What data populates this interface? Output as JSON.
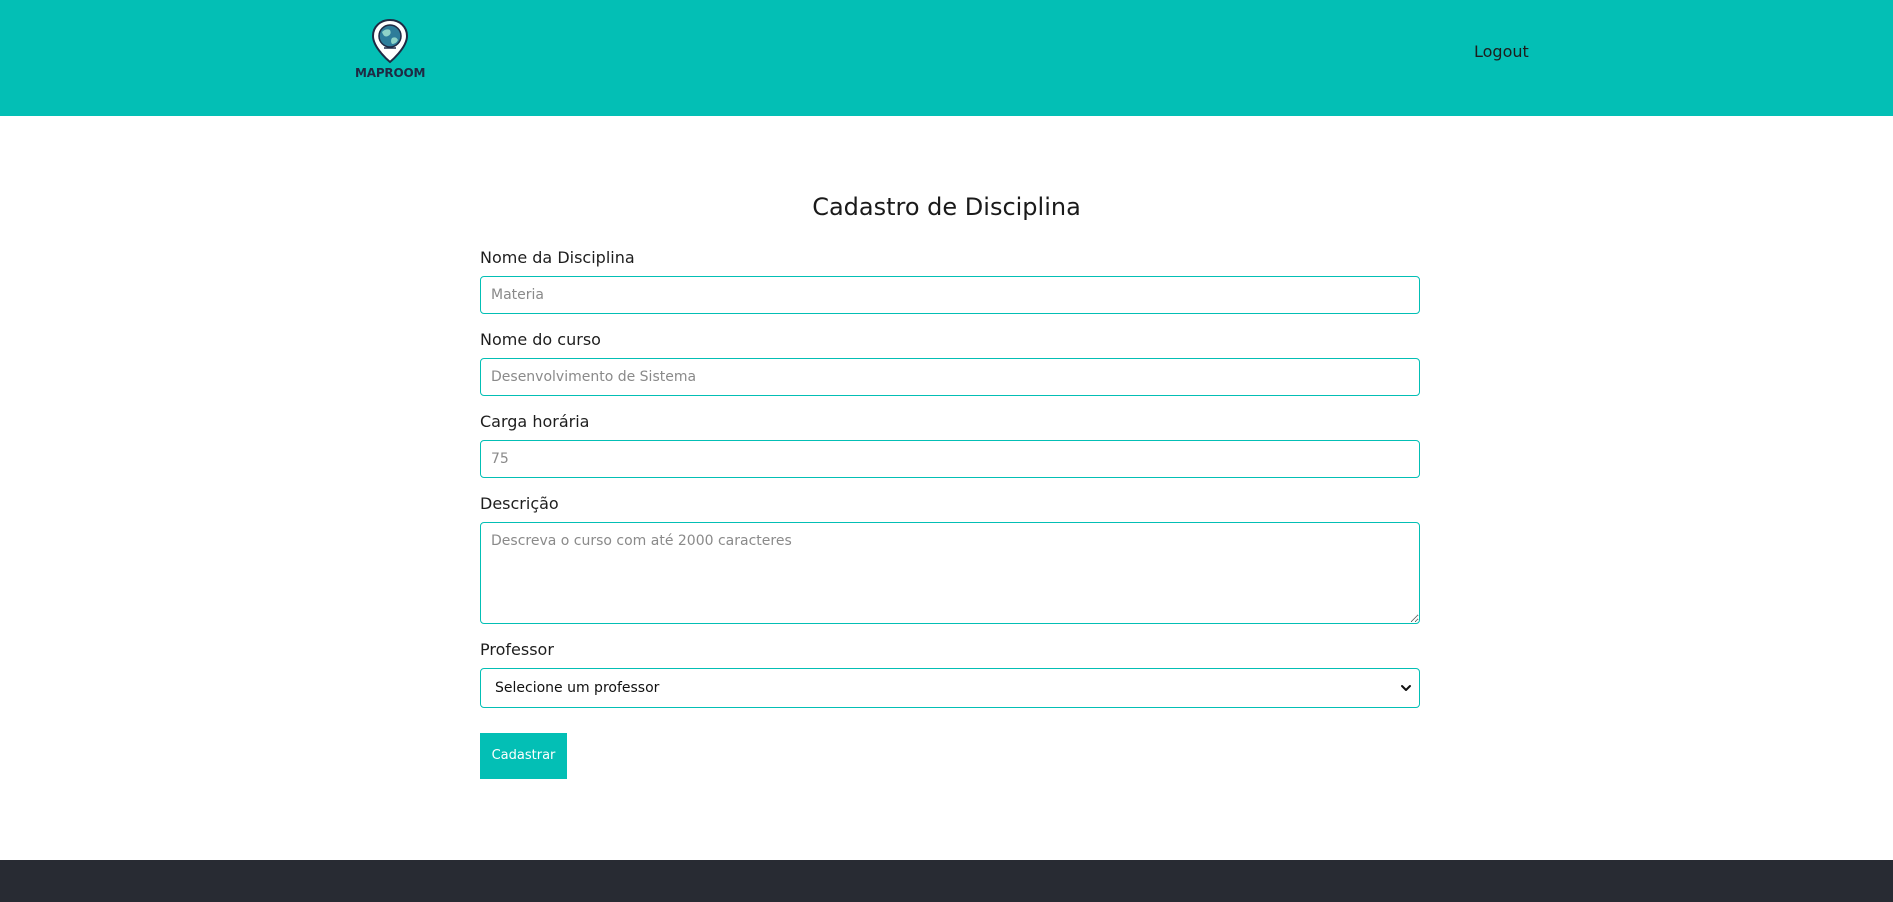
{
  "header": {
    "logo_text": "MAPROOM",
    "logout_label": "Logout",
    "bg_color": "#03bfb5"
  },
  "form": {
    "title": "Cadastro de Disciplina",
    "fields": {
      "discipline_name": {
        "label": "Nome da Disciplina",
        "placeholder": "Materia"
      },
      "course_name": {
        "label": "Nome do curso",
        "placeholder": "Desenvolvimento de Sistema"
      },
      "workload": {
        "label": "Carga horária",
        "placeholder": "75"
      },
      "description": {
        "label": "Descrição",
        "placeholder": "Descreva o curso com até 2000 caracteres"
      },
      "professor": {
        "label": "Professor",
        "selected": "Selecione um professor"
      }
    },
    "submit_label": "Cadastrar"
  },
  "icons": {
    "logo": "map-pin-globe-icon",
    "select_arrow": "chevron-down-icon"
  }
}
